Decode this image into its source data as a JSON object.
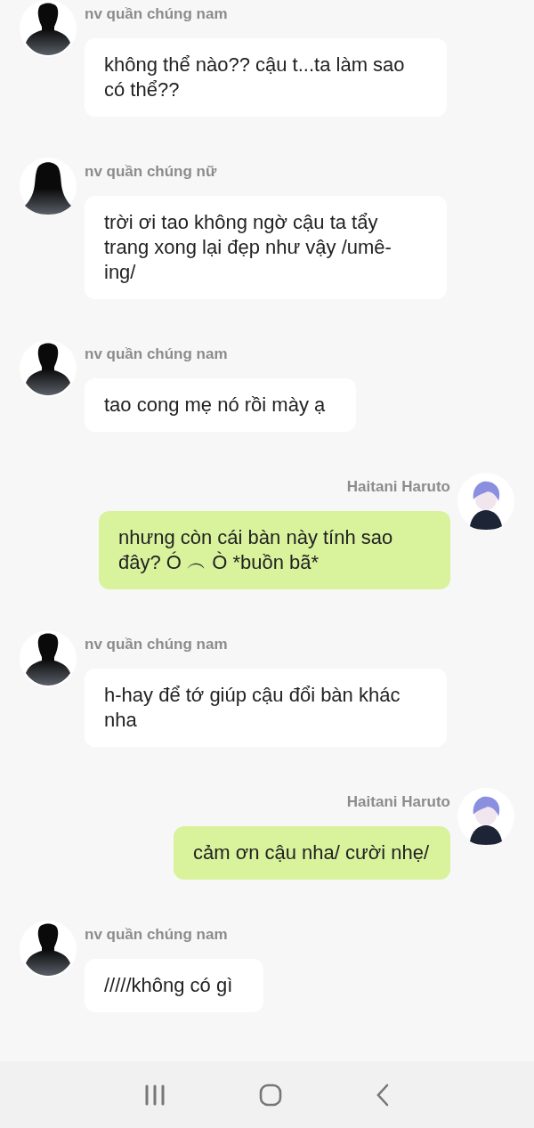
{
  "messages": [
    {
      "kind": "incoming",
      "avatar": {
        "kind": "male"
      },
      "sender": "nv quần chúng nam",
      "text": "không thể nào?? cậu t...ta làm sao có thể??"
    },
    {
      "kind": "incoming",
      "avatar": {
        "kind": "female"
      },
      "sender": "nv quần chúng nữ",
      "text": "trời ơi tao không ngờ cậu ta tẩy trang xong lại đẹp như vậy /umê-ing/"
    },
    {
      "kind": "incoming",
      "avatar": {
        "kind": "male"
      },
      "sender": "nv quần chúng nam",
      "text": "tao cong mẹ nó rồi mày ạ"
    },
    {
      "kind": "outgoing",
      "avatar": {
        "kind": "character"
      },
      "sender": "Haitani Haruto",
      "text": "nhưng còn cái bàn này tính sao đây? Ó ︵ Ò *buồn bã*"
    },
    {
      "kind": "incoming",
      "avatar": {
        "kind": "male"
      },
      "sender": "nv quần chúng nam",
      "text": "h-hay để tớ giúp cậu đổi bàn khác nha"
    },
    {
      "kind": "outgoing",
      "avatar": {
        "kind": "character"
      },
      "sender": "Haitani Haruto",
      "text": "cảm ơn cậu nha/ cười nhẹ/"
    },
    {
      "kind": "incoming",
      "avatar": {
        "kind": "male"
      },
      "sender": "nv quần chúng nam",
      "text": "/////không có gì"
    }
  ]
}
